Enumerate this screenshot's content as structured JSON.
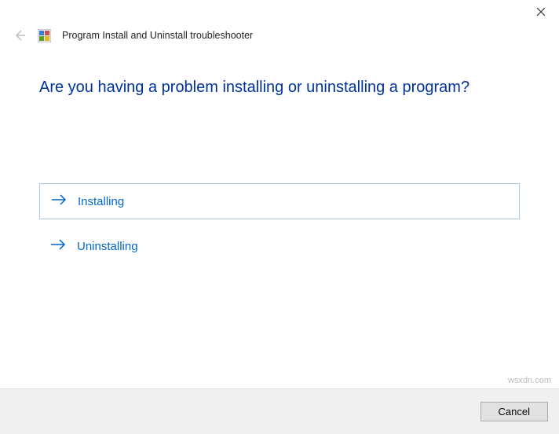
{
  "header": {
    "title": "Program Install and Uninstall troubleshooter"
  },
  "main": {
    "heading": "Are you having a problem installing or uninstalling a program?",
    "options": [
      {
        "label": "Installing",
        "selected": true
      },
      {
        "label": "Uninstalling",
        "selected": false
      }
    ]
  },
  "footer": {
    "cancel_label": "Cancel"
  },
  "watermark": "wsxdn.com"
}
